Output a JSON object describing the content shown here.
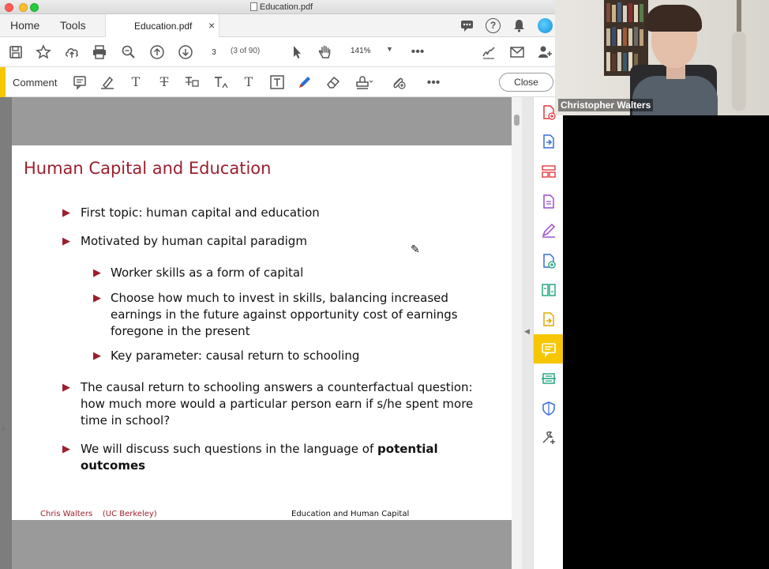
{
  "window": {
    "title": "Education.pdf"
  },
  "tabs": {
    "home": "Home",
    "tools": "Tools",
    "document": "Education.pdf",
    "close_glyph": "×"
  },
  "toolbar": {
    "page_number": "3",
    "page_of": "(3 of 90)",
    "zoom": "141%"
  },
  "comment_bar": {
    "label": "Comment",
    "close": "Close"
  },
  "slide": {
    "title": "Human Capital and Education",
    "bullets": [
      "First topic: human capital and education",
      "Motivated by human capital paradigm",
      "Worker skills as a form of capital",
      "Choose how much to invest in skills, balancing increased",
      "earnings in the future against opportunity cost of earnings",
      "foregone in the present",
      "Key parameter: causal return to schooling",
      "The causal return to schooling answers a counterfactual question:",
      "how much more would a particular person earn if s/he spent more",
      "time in school?",
      "We will discuss such questions in the language of ",
      "potential",
      "outcomes"
    ],
    "footer_left": "Chris Walters    (UC Berkeley)",
    "footer_right": "Education and Human Capital"
  },
  "video": {
    "speaker": "Christopher Walters"
  },
  "colors": {
    "slide_accent": "#9c1f2e",
    "comment_accent": "#f6c700"
  },
  "icons": [
    "save-icon",
    "star-icon",
    "upload-icon",
    "print-icon",
    "zoom-search-icon",
    "page-up-icon",
    "page-down-icon",
    "select-cursor-icon",
    "hand-icon",
    "more-icon",
    "sign-icon",
    "mail-icon",
    "add-user-icon",
    "sticky-note-icon",
    "highlight-icon",
    "text-icon",
    "strikethrough-icon",
    "replace-text-icon",
    "insert-text-icon",
    "add-text-icon",
    "text-box-icon",
    "draw-icon",
    "eraser-icon",
    "stamp-icon",
    "attach-icon"
  ]
}
